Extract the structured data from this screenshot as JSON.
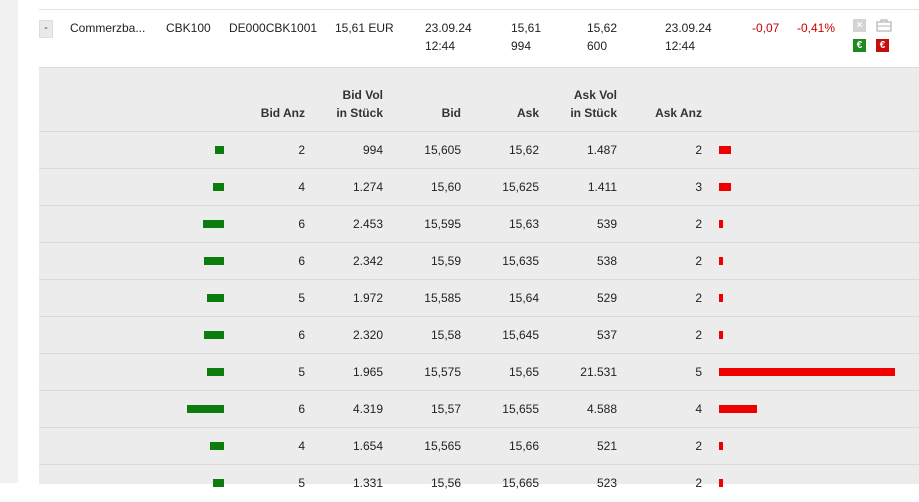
{
  "quote": {
    "toggle": "-",
    "name": "Commerzba...",
    "symbol": "CBK100",
    "isin": "DE000CBK1001",
    "last": "15,61 EUR",
    "date1": "23.09.24",
    "time1": "12:44",
    "bid": "15,61",
    "bid_vol": "994",
    "ask": "15,62",
    "ask_vol": "600",
    "date2": "23.09.24",
    "time2": "12:44",
    "change": "-0,07",
    "change_pct": "-0,41%",
    "buy_icon": "€",
    "sell_icon": "€",
    "close_icon": "×"
  },
  "book": {
    "headers": {
      "bid_count": "Bid Anz",
      "bid_vol_1": "Bid Vol",
      "bid_vol_2": "in Stück",
      "bid": "Bid",
      "ask": "Ask",
      "ask_vol_1": "Ask Vol",
      "ask_vol_2": "in Stück",
      "ask_count": "Ask Anz"
    },
    "rows": [
      {
        "bid_count": "2",
        "bid_vol": "994",
        "bid": "15,605",
        "ask": "15,62",
        "ask_vol": "1.487",
        "ask_count": "2",
        "bid_vol_num": 994,
        "ask_vol_num": 1487
      },
      {
        "bid_count": "4",
        "bid_vol": "1.274",
        "bid": "15,60",
        "ask": "15,625",
        "ask_vol": "1.411",
        "ask_count": "3",
        "bid_vol_num": 1274,
        "ask_vol_num": 1411
      },
      {
        "bid_count": "6",
        "bid_vol": "2.453",
        "bid": "15,595",
        "ask": "15,63",
        "ask_vol": "539",
        "ask_count": "2",
        "bid_vol_num": 2453,
        "ask_vol_num": 539
      },
      {
        "bid_count": "6",
        "bid_vol": "2.342",
        "bid": "15,59",
        "ask": "15,635",
        "ask_vol": "538",
        "ask_count": "2",
        "bid_vol_num": 2342,
        "ask_vol_num": 538
      },
      {
        "bid_count": "5",
        "bid_vol": "1.972",
        "bid": "15,585",
        "ask": "15,64",
        "ask_vol": "529",
        "ask_count": "2",
        "bid_vol_num": 1972,
        "ask_vol_num": 529
      },
      {
        "bid_count": "6",
        "bid_vol": "2.320",
        "bid": "15,58",
        "ask": "15,645",
        "ask_vol": "537",
        "ask_count": "2",
        "bid_vol_num": 2320,
        "ask_vol_num": 537
      },
      {
        "bid_count": "5",
        "bid_vol": "1.965",
        "bid": "15,575",
        "ask": "15,65",
        "ask_vol": "21.531",
        "ask_count": "5",
        "bid_vol_num": 1965,
        "ask_vol_num": 21531
      },
      {
        "bid_count": "6",
        "bid_vol": "4.319",
        "bid": "15,57",
        "ask": "15,655",
        "ask_vol": "4.588",
        "ask_count": "4",
        "bid_vol_num": 4319,
        "ask_vol_num": 4588
      },
      {
        "bid_count": "4",
        "bid_vol": "1.654",
        "bid": "15,565",
        "ask": "15,66",
        "ask_vol": "521",
        "ask_count": "2",
        "bid_vol_num": 1654,
        "ask_vol_num": 521
      },
      {
        "bid_count": "5",
        "bid_vol": "1.331",
        "bid": "15,56",
        "ask": "15,665",
        "ask_vol": "523",
        "ask_count": "2",
        "bid_vol_num": 1331,
        "ask_vol_num": 523
      }
    ]
  },
  "colors": {
    "bid_bar": "#0c7d0c",
    "ask_bar": "#ee0000",
    "negative": "#cc0000"
  }
}
